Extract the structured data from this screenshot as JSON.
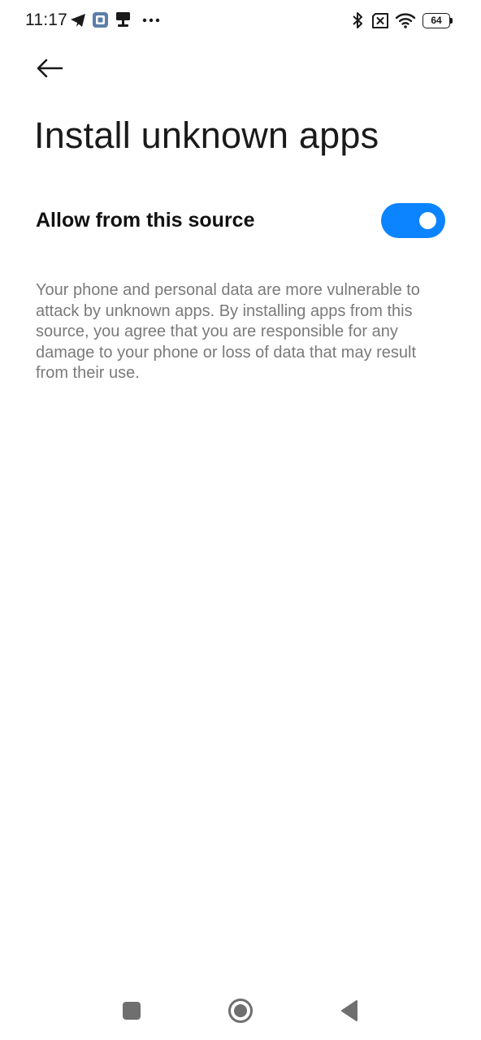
{
  "status_bar": {
    "time": "11:17",
    "battery_level": "64",
    "icons": [
      "telegram-icon",
      "app-notification-icon",
      "signpost-icon",
      "more-dots-icon",
      "bluetooth-icon",
      "no-sim-icon",
      "wifi-icon",
      "battery-icon"
    ]
  },
  "header": {
    "back_icon": "arrow-left-icon",
    "title": "Install unknown apps"
  },
  "setting": {
    "label": "Allow from this source",
    "toggle_on": true,
    "toggle_color": "#0d84ff"
  },
  "description": "Your phone and personal data are more vulnerable to attack by unknown apps. By installing apps from this source, you agree that you are responsible for any damage to your phone or loss of data that may result from their use.",
  "nav_bar": {
    "icons": [
      "recents-square-icon",
      "home-circle-icon",
      "back-triangle-icon"
    ]
  }
}
